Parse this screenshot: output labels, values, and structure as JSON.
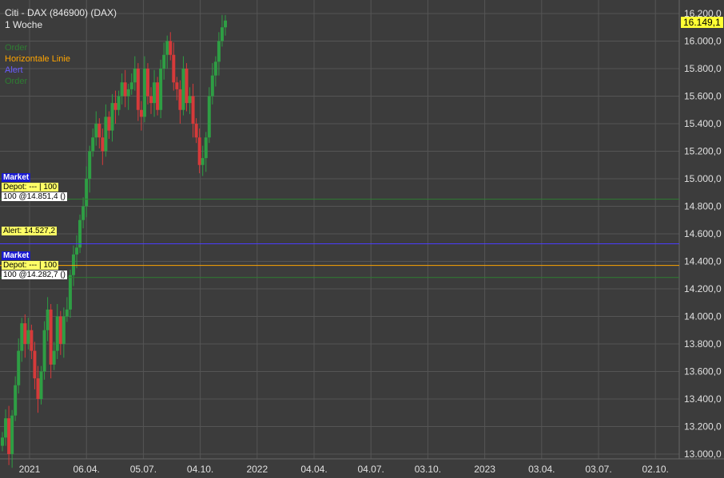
{
  "header": {
    "title": "Citi - DAX (846900) (DAX)",
    "period": "1 Woche"
  },
  "legend": {
    "items": [
      {
        "label": "Order",
        "color": "#2e7d32"
      },
      {
        "label": "Horizontale Linie",
        "color": "#ffa500"
      },
      {
        "label": "Alert",
        "color": "#6a5cff"
      },
      {
        "label": "Order",
        "color": "#2e7d32"
      }
    ]
  },
  "orders": [
    {
      "market": "Market",
      "depot": "Depot: --- | 100",
      "order": "100 @14.851,4 ()",
      "price": 14851.4,
      "color": "#2e7d32"
    },
    {
      "market": "Market",
      "depot": "Depot: --- | 100",
      "order": "100 @14.282,7 ()",
      "price": 14282.7,
      "color": "#2e7d32"
    }
  ],
  "alert": {
    "label": "Alert: 14.527,2",
    "price": 14527.2,
    "color": "#4a3cff"
  },
  "horizontal_line": {
    "price": 14370,
    "color": "#ffa500"
  },
  "last_price": {
    "label": "16.149,1",
    "value": 16149.1
  },
  "colors": {
    "up": "#2e9e44",
    "down": "#d63a3a",
    "grid": "#555555",
    "background": "#3c3c3c"
  },
  "chart_data": {
    "type": "candlestick",
    "ylim": [
      13000,
      16200
    ],
    "y_ticks": [
      "16.200,0",
      "16.000,0",
      "15.800,0",
      "15.600,0",
      "15.400,0",
      "15.200,0",
      "15.000,0",
      "14.800,0",
      "14.600,0",
      "14.400,0",
      "14.200,0",
      "14.000,0",
      "13.800,0",
      "13.600,0",
      "13.400,0",
      "13.200,0",
      "13.000,0"
    ],
    "x_ticks": [
      "2021",
      "06.04.",
      "05.07.",
      "04.10.",
      "2022",
      "04.04.",
      "04.07.",
      "03.10.",
      "2023",
      "03.04.",
      "03.07.",
      "02.10."
    ],
    "grid": true,
    "closes": [
      13120,
      13260,
      13000,
      13280,
      13500,
      13750,
      13950,
      13800,
      13900,
      13750,
      13550,
      13400,
      13600,
      13900,
      14050,
      13650,
      13750,
      14000,
      13800,
      14000,
      14050,
      14300,
      14450,
      14500,
      14700,
      14800,
      15000,
      15200,
      15300,
      15400,
      15300,
      15200,
      15450,
      15350,
      15550,
      15500,
      15600,
      15700,
      15600,
      15650,
      15700,
      15800,
      15500,
      15450,
      15800,
      15600,
      15550,
      15700,
      15500,
      15800,
      15900,
      16000,
      15900,
      15700,
      15650,
      15500,
      15800,
      15550,
      15600,
      15400,
      15300,
      15100,
      15150,
      15300,
      15600,
      15750,
      15850,
      16000,
      16100,
      16149.1
    ]
  }
}
